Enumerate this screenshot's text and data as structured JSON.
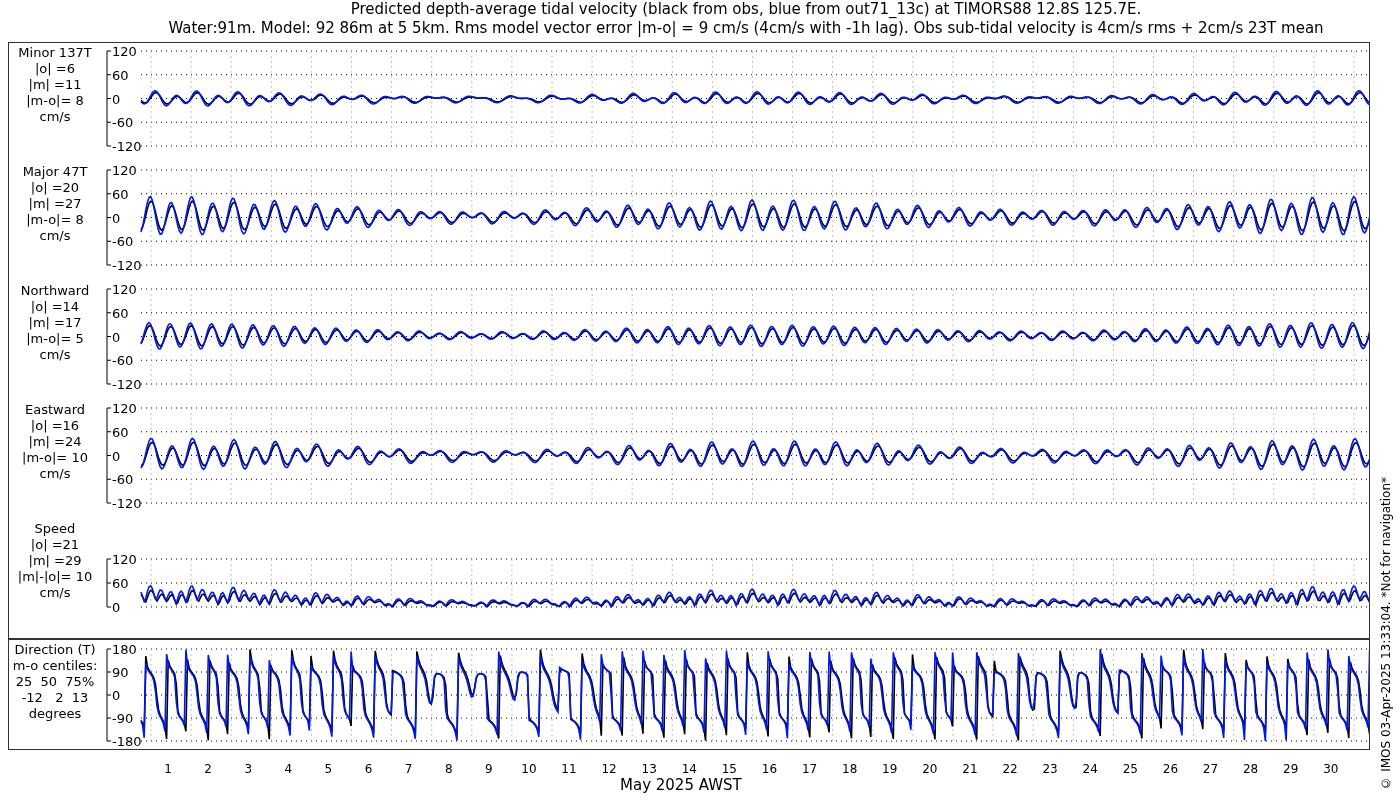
{
  "title": {
    "line_1": "Predicted depth-average tidal velocity (black from obs, blue from out71_13c) at TIMORS88 12.8S 125.7E.",
    "line_2": "Water:91m. Model: 92 86m at 5 5km. Rms model vector error |m-o| = 9 cm/s (4cm/s with -1h lag). Obs sub-tidal velocity is 4cm/s rms + 2cm/s 23T mean"
  },
  "panels": [
    {
      "kind": "velocity",
      "label_lines": [
        "Minor 137T",
        "|o| =6",
        "|m| =11",
        "|m-o|= 8",
        "cm/s"
      ],
      "yticks": [
        "120",
        "60",
        "0",
        "-60",
        "-120"
      ]
    },
    {
      "kind": "velocity",
      "label_lines": [
        "Major 47T",
        "|o| =20",
        "|m| =27",
        "|m-o|= 8",
        "cm/s"
      ],
      "yticks": [
        "120",
        "60",
        "0",
        "-60",
        "-120"
      ]
    },
    {
      "kind": "velocity",
      "label_lines": [
        "Northward",
        "|o| =14",
        "|m| =17",
        "|m-o|= 5",
        "cm/s"
      ],
      "yticks": [
        "120",
        "60",
        "0",
        "-60",
        "-120"
      ]
    },
    {
      "kind": "velocity",
      "label_lines": [
        "Eastward",
        "|o| =16",
        "|m| =24",
        "|m-o|= 10",
        "cm/s"
      ],
      "yticks": [
        "120",
        "60",
        "0",
        "-60",
        "-120"
      ]
    },
    {
      "kind": "speed",
      "label_lines": [
        "Speed",
        "|o| =21",
        "|m| =29",
        "|m|-|o|= 10",
        "cm/s"
      ],
      "yticks": [
        "120",
        "60",
        "0"
      ]
    },
    {
      "kind": "direction",
      "label_lines": [
        "Direction (T)",
        "m-o centiles:",
        "25  50  75%",
        "-12   2  13",
        "degrees"
      ],
      "yticks": [
        "180",
        "90",
        "0",
        "-90",
        "-180"
      ]
    }
  ],
  "x_axis": {
    "day_labels": [
      "1",
      "2",
      "3",
      "4",
      "5",
      "6",
      "7",
      "8",
      "9",
      "10",
      "11",
      "12",
      "13",
      "14",
      "15",
      "16",
      "17",
      "18",
      "19",
      "20",
      "21",
      "22",
      "23",
      "24",
      "25",
      "26",
      "27",
      "28",
      "29",
      "30"
    ],
    "xlabel": "May 2025 AWST"
  },
  "copyright": "© IMOS 03-Apr-2025 13:33:04. *Not for navigation*"
}
